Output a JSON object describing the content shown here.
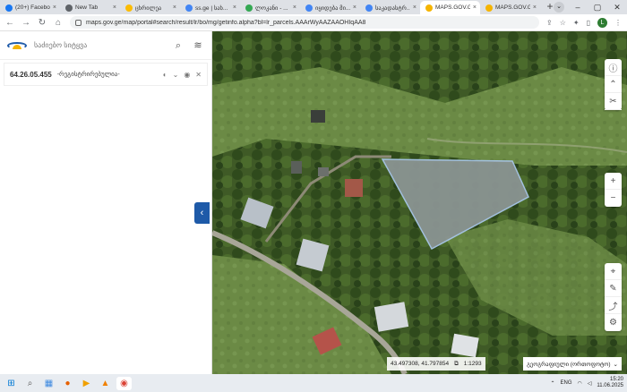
{
  "browser": {
    "tabs": [
      {
        "title": "(20+) Facebo",
        "color": "#1877f2",
        "active": false
      },
      {
        "title": "New Tab",
        "color": "#5f6368",
        "active": false
      },
      {
        "title": "ცხრილეა",
        "color": "#fbbc04",
        "active": false
      },
      {
        "title": "ss.ge | სახ...",
        "color": "#4285f4",
        "active": false
      },
      {
        "title": "ლოკანი - ...",
        "color": "#34a853",
        "active": false
      },
      {
        "title": "იყიდება მი...",
        "color": "#4285f4",
        "active": false
      },
      {
        "title": "საკადასტრ...",
        "color": "#4285f4",
        "active": false
      },
      {
        "title": "MAPS.GOV.G",
        "color": "#f5b400",
        "active": true
      },
      {
        "title": "MAPS.GOV.G",
        "color": "#f5b400",
        "active": false
      }
    ],
    "url": "maps.gov.ge/map/portal#search/result/lr/bo/mg/getinfo.alpha?bl=lr_parcels.AAArWyAAZAAOHIqAA8",
    "profile_initial": "L"
  },
  "panel": {
    "search_placeholder": "საძიებო სიტყვა",
    "parcel_code": "64.26.05.455",
    "parcel_type": "-რეგისტრირებულია-"
  },
  "map": {
    "coordinates": "43.497308, 41.797854",
    "scale": "1:1293",
    "basemap_label": "გეოგრაფიული (ორთოფოტო)"
  },
  "taskbar": {
    "language": "ENG",
    "time": "15:20",
    "date": "11.06.2025"
  }
}
